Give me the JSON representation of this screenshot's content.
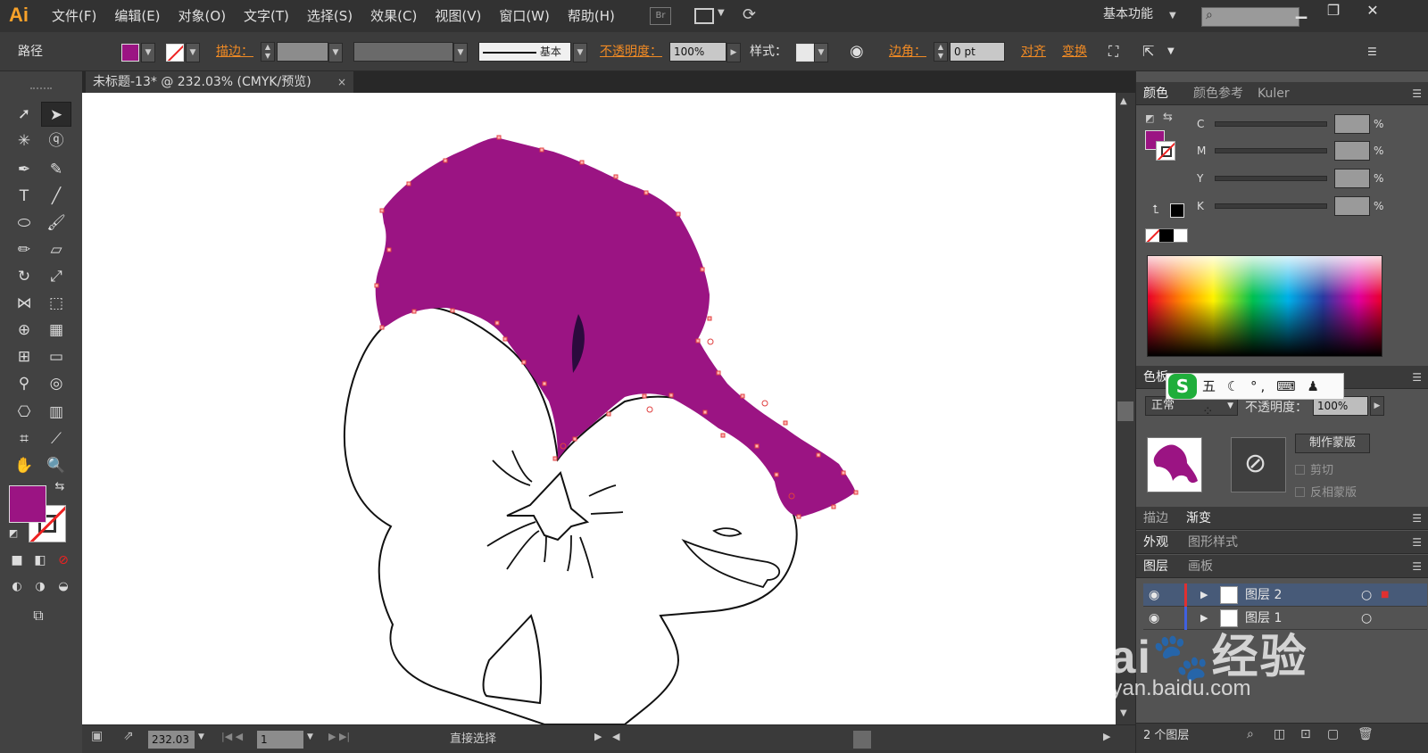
{
  "app": {
    "logo": "Ai"
  },
  "menu": [
    "文件(F)",
    "编辑(E)",
    "对象(O)",
    "文字(T)",
    "选择(S)",
    "效果(C)",
    "视图(V)",
    "窗口(W)",
    "帮助(H)"
  ],
  "header": {
    "bridge": "Br",
    "workspace": "基本功能"
  },
  "controlbar": {
    "object_type": "路径",
    "fill_color": "#9b1483",
    "stroke_label": "描边：",
    "stroke_style": "基本",
    "opacity_label": "不透明度：",
    "opacity_value": "100%",
    "style_label": "样式：",
    "corner_label": "边角：",
    "corner_value": "0 pt",
    "align_label": "对齐",
    "transform_label": "变换"
  },
  "document": {
    "tab_title": "未标题-13* @ 232.03% (CMYK/预览)",
    "close": "×"
  },
  "status": {
    "zoom": "232.03",
    "page": "1",
    "tool": "直接选择"
  },
  "color_panel": {
    "tabs": [
      "颜色",
      "颜色参考",
      "Kuler"
    ],
    "channels": [
      "C",
      "M",
      "Y",
      "K"
    ],
    "percent": "%"
  },
  "transparency_panel": {
    "tab": "色板",
    "blend_mode": "正常",
    "opacity_label": "不透明度：",
    "opacity_value": "100%",
    "make_mask": "制作蒙版",
    "clip": "剪切",
    "invert_mask": "反相蒙版"
  },
  "stroke_gradient_tabs": [
    "描边",
    "渐变"
  ],
  "appearance_tabs": [
    "外观",
    "图形样式"
  ],
  "layers_tabs": [
    "图层",
    "画板"
  ],
  "layers": [
    {
      "name": "图层 2",
      "selected": true
    },
    {
      "name": "图层 1",
      "selected": false
    }
  ],
  "layers_footer": "2 个图层",
  "ime": {
    "label": "五"
  },
  "watermark": {
    "brand": "Bai",
    "brand2": "经验",
    "url": "jingyan.baidu.com"
  },
  "colors": {
    "accent_purple": "#9b1483",
    "dark_purple": "#2b0a3d",
    "highlight_orange": "#f08a24"
  }
}
